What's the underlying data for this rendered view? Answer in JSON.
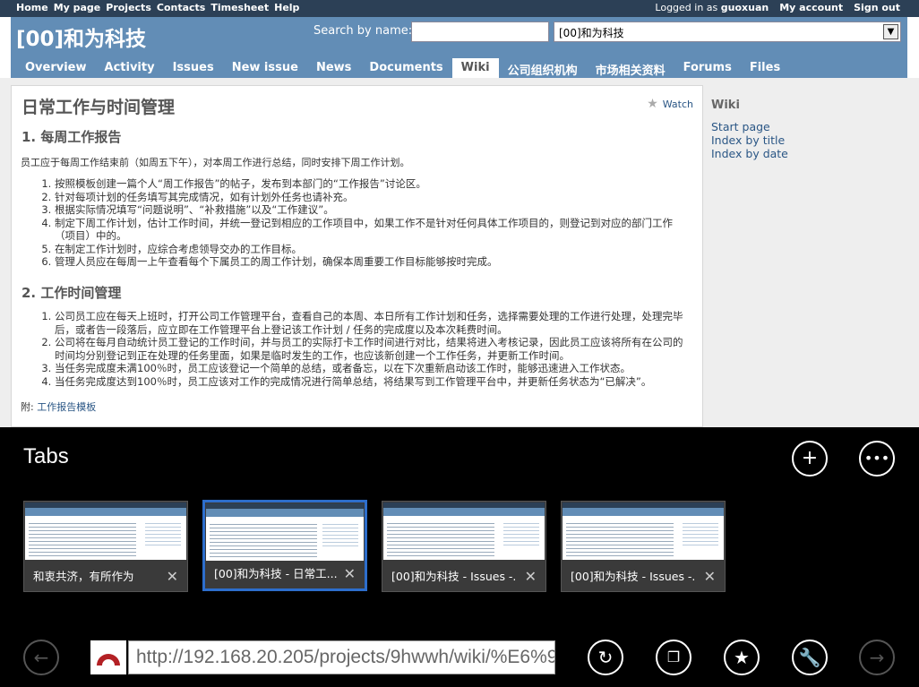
{
  "top_menu": {
    "links": [
      "Home",
      "My page",
      "Projects",
      "Contacts",
      "Timesheet",
      "Help"
    ],
    "logged_in_as": "Logged in as",
    "username": "guoxuan",
    "my_account": "My account",
    "sign_out": "Sign out"
  },
  "header": {
    "project_title": "[00]和为科技",
    "search_label": "Search by name:",
    "search_value": "",
    "jump_value": "[00]和为科技"
  },
  "main_menu": {
    "tabs": [
      "Overview",
      "Activity",
      "Issues",
      "New issue",
      "News",
      "Documents",
      "Wiki",
      "公司组织机构",
      "市场相关资料",
      "Forums",
      "Files"
    ],
    "selected": "Wiki"
  },
  "content": {
    "title": "日常工作与时间管理",
    "watch": "Watch",
    "section1_title": "1. 每周工作报告",
    "section1_intro": "员工应于每周工作结束前（如周五下午），对本周工作进行总结，同时安排下周工作计划。",
    "section1_items": [
      "按照模板创建一篇个人“周工作报告”的帖子，发布到本部门的“工作报告”讨论区。",
      "针对每项计划的任务填写其完成情况，如有计划外任务也请补充。",
      "根据实际情况填写“问题说明”、“补救措施”以及“工作建议”。",
      "制定下周工作计划，估计工作时间，并统一登记到相应的工作项目中，如果工作不是针对任何具体工作项目的，则登记到对应的部门工作（项目）中的。",
      "在制定工作计划时，应综合考虑领导交办的工作目标。",
      "管理人员应在每周一上午查看每个下属员工的周工作计划，确保本周重要工作目标能够按时完成。"
    ],
    "section2_title": "2. 工作时间管理",
    "section2_items": [
      "公司员工应在每天上班时，打开公司工作管理平台，查看自己的本周、本日所有工作计划和任务，选择需要处理的工作进行处理，处理完毕后，或者告一段落后，应立即在工作管理平台上登记该工作计划 / 任务的完成度以及本次耗费时间。",
      "公司将在每月自动统计员工登记的工作时间，并与员工的实际打卡工作时间进行对比，结果将进入考核记录，因此员工应该将所有在公司的时间均分别登记到正在处理的任务里面，如果是临时发生的工作，也应该新创建一个工作任务，并更新工作时间。",
      "当任务完成度未满100％时，员工应该登记一个简单的总结，或者备忘，以在下次重新启动该工作时，能够迅速进入工作状态。",
      "当任务完成度达到100％时，员工应该对工作的完成情况进行简单总结，将结果写到工作管理平台中，并更新任务状态为“已解决”。"
    ],
    "attachment_prefix": "附:",
    "attachment_link": "工作报告模板"
  },
  "sidebar": {
    "heading": "Wiki",
    "links": [
      "Start page",
      "Index by title",
      "Index by date"
    ]
  },
  "tabs_panel": {
    "heading": "Tabs",
    "tabs": [
      {
        "label": "和衷共济，有所作为",
        "active": false
      },
      {
        "label": "[00]和为科技 - 日常工...",
        "active": true
      },
      {
        "label": "[00]和为科技 - Issues -...",
        "active": false
      },
      {
        "label": "[00]和为科技 - Issues -...",
        "active": false
      }
    ]
  },
  "address_bar": {
    "url": "http://192.168.20.205/projects/9hwwh/wiki/%E6%9"
  },
  "colors": {
    "top_menu_bg": "#2c4056",
    "header_bg": "#628db6",
    "link": "#2a5685",
    "active_tab_border": "#2d6ecc"
  }
}
